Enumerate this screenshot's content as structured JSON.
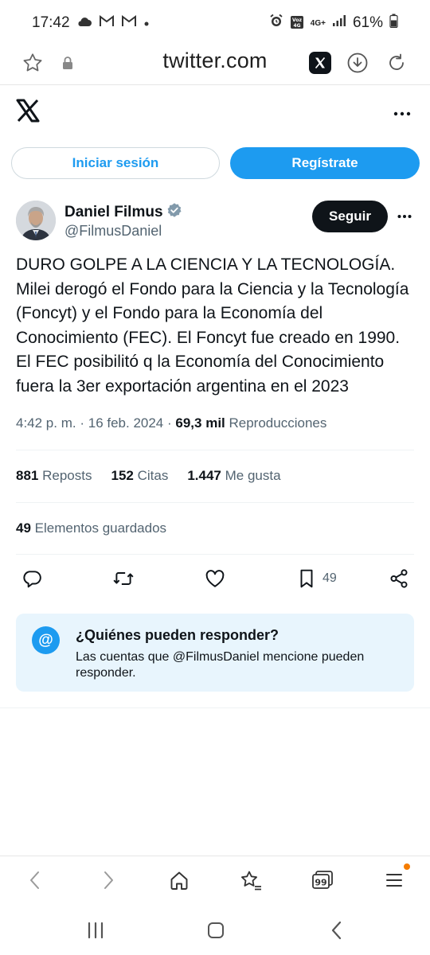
{
  "status_bar": {
    "time": "17:42",
    "volte": "Voz 4G",
    "network": "4G+",
    "battery": "61%"
  },
  "browser": {
    "url": "twitter.com"
  },
  "auth": {
    "login_label": "Iniciar sesión",
    "signup_label": "Regístrate"
  },
  "tweet": {
    "author_name": "Daniel Filmus",
    "handle": "@FilmusDaniel",
    "follow_label": "Seguir",
    "text": "DURO GOLPE A LA CIENCIA Y LA TECNOLOGÍA. Milei derogó el Fondo para la Ciencia y la Tecnología (Foncyt) y el Fondo para la Economía del Conocimiento (FEC). El Foncyt fue creado en 1990. El FEC posibilitó q la Economía del Conocimiento fuera la 3er exportación argentina en el 2023",
    "time": "4:42 p. m.",
    "date": "16 feb. 2024",
    "views_count": "69,3 mil",
    "views_label": "Reproducciones",
    "reposts_count": "881",
    "reposts_label": "Reposts",
    "quotes_count": "152",
    "quotes_label": "Citas",
    "likes_count": "1.447",
    "likes_label": "Me gusta",
    "bookmarks_count": "49",
    "bookmarks_label": "Elementos guardados",
    "bookmark_action_count": "49"
  },
  "who_can_reply": {
    "title": "¿Quiénes pueden responder?",
    "description": "Las cuentas que @FilmusDaniel mencione pueden responder."
  },
  "bottom_toolbar": {
    "tabs_count": "99"
  },
  "colors": {
    "brand_blue": "#1d9bf0",
    "text_primary": "#0f1419",
    "text_secondary": "#536471",
    "reply_box_bg": "#e8f5fd",
    "notification_dot": "#f57c00"
  }
}
